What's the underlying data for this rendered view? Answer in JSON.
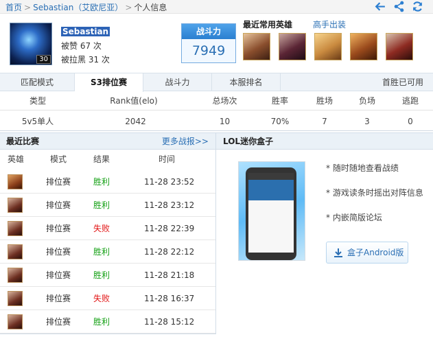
{
  "breadcrumb": {
    "home": "首页",
    "player": "Sebastian（艾欧尼亚）",
    "current": "个人信息"
  },
  "profile": {
    "level": "30",
    "name": "Sebastian",
    "likes": "被赞 67 次",
    "blocks": "被拉黑 31 次"
  },
  "power": {
    "label": "战斗力",
    "value": "7949"
  },
  "heroes": {
    "title": "最近常用英雄",
    "link": "高手出装"
  },
  "tabs": [
    "匹配模式",
    "S3排位赛",
    "战斗力",
    "本服排名"
  ],
  "first_win": "首胜已可用",
  "rank": {
    "headers": [
      "类型",
      "Rank值(elo)",
      "总场次",
      "胜率",
      "胜场",
      "负场",
      "逃跑"
    ],
    "row": [
      "5v5单人",
      "2042",
      "10",
      "70%",
      "7",
      "3",
      "0"
    ]
  },
  "recent": {
    "title": "最近比赛",
    "more": "更多战报>>",
    "columns": [
      "英雄",
      "模式",
      "结果",
      "时间"
    ],
    "matches": [
      {
        "mode": "排位赛",
        "result": "胜利",
        "time": "11-28 23:52"
      },
      {
        "mode": "排位赛",
        "result": "胜利",
        "time": "11-28 23:12"
      },
      {
        "mode": "排位赛",
        "result": "失败",
        "time": "11-28 22:39"
      },
      {
        "mode": "排位赛",
        "result": "胜利",
        "time": "11-28 22:12"
      },
      {
        "mode": "排位赛",
        "result": "胜利",
        "time": "11-28 21:18"
      },
      {
        "mode": "排位赛",
        "result": "失败",
        "time": "11-28 16:37"
      },
      {
        "mode": "排位赛",
        "result": "胜利",
        "time": "11-28 15:12"
      }
    ]
  },
  "box": {
    "title": "LOL迷你盒子",
    "features": [
      "* 随时随地查看战绩",
      "* 游戏读条时摇出对阵信息",
      "* 内嵌简版论坛"
    ],
    "download": "盒子Android版"
  },
  "colors": {
    "win": "#13a013",
    "lose": "#e21414",
    "accent": "#2a6fb4"
  }
}
